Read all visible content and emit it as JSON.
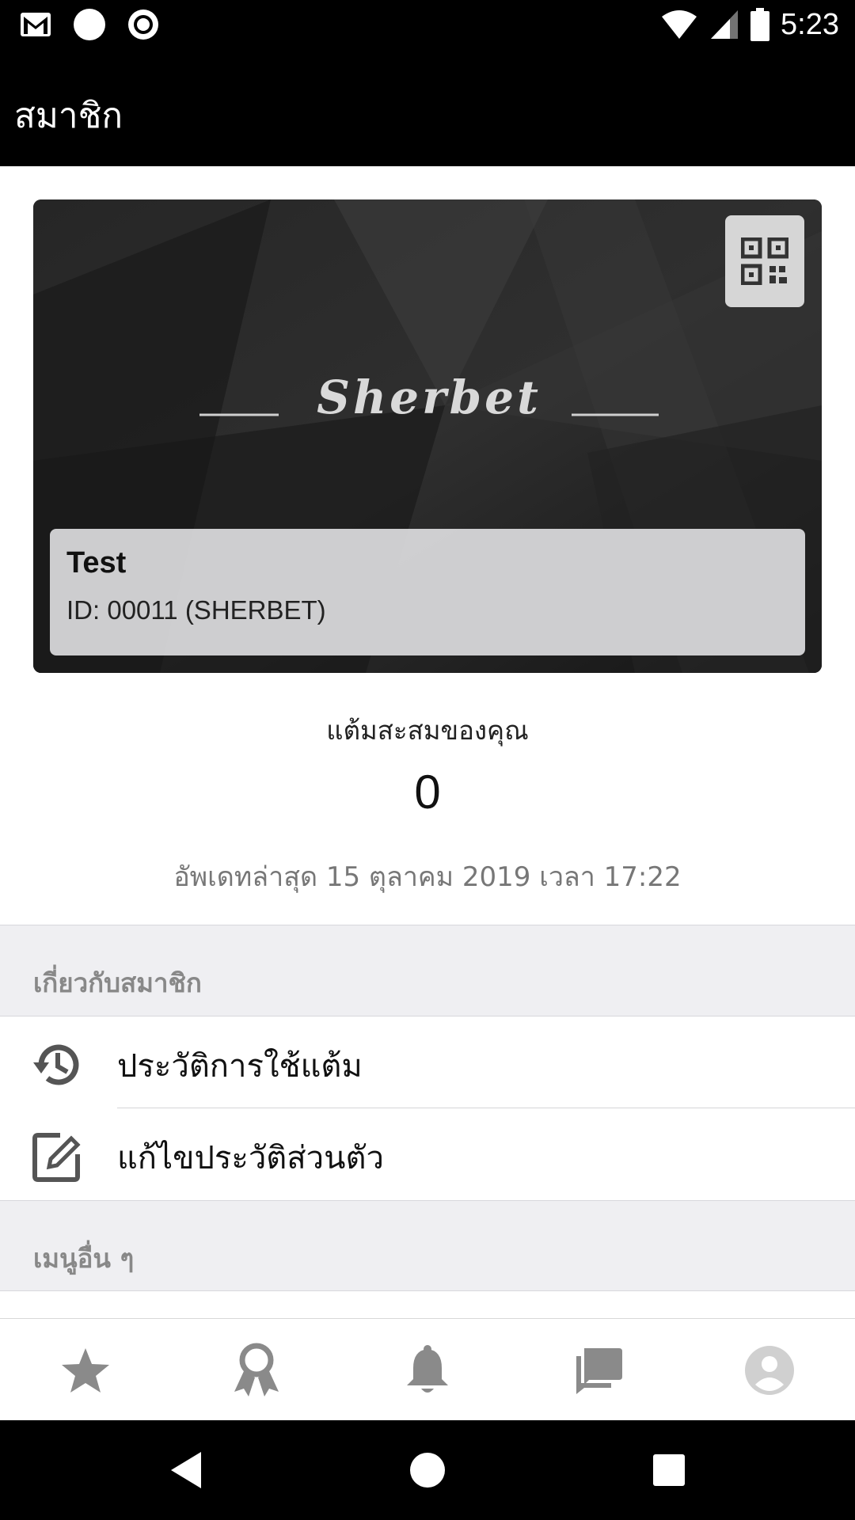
{
  "status_bar": {
    "time": "5:23",
    "icons": [
      "gmail-icon",
      "circle-icon",
      "record-icon",
      "wifi-icon",
      "cell-signal-icon",
      "battery-icon"
    ]
  },
  "app_bar": {
    "title": "สมาชิก"
  },
  "member_card": {
    "brand": "Sherbet",
    "name": "Test",
    "id_text": "ID: 00011 (SHERBET)",
    "qr_icon": "qr-code-icon"
  },
  "points": {
    "label": "แต้มสะสมของคุณ",
    "value": "0",
    "updated": "อัพเดทล่าสุด 15 ตุลาคม 2019 เวลา 17:22"
  },
  "sections": [
    {
      "header": "เกี่ยวกับสมาชิก",
      "items": [
        {
          "label": "ประวัติการใช้แต้ม",
          "icon": "history-icon"
        },
        {
          "label": "แก้ไขประวัติส่วนตัว",
          "icon": "edit-icon"
        }
      ]
    },
    {
      "header": "เมนูอื่น ๆ",
      "items": []
    }
  ],
  "bottom_nav": [
    "star-icon",
    "award-icon",
    "bell-icon",
    "chat-icon",
    "account-icon"
  ],
  "colors": {
    "bar": "#000000",
    "section_bg": "#efeff2",
    "icon_gray": "#555555",
    "nav_icon": "#8a8a8a"
  }
}
